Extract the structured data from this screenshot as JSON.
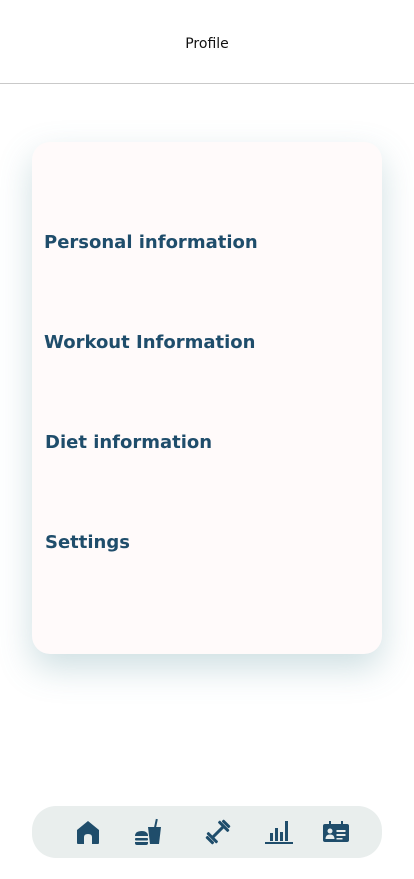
{
  "header": {
    "title": "Profile"
  },
  "menu": {
    "items": [
      {
        "label": "Personal information"
      },
      {
        "label": "Workout Information"
      },
      {
        "label": "Diet information"
      },
      {
        "label": "Settings"
      }
    ]
  },
  "bottom_nav": {
    "items": [
      {
        "icon": "home-icon"
      },
      {
        "icon": "food-drink-icon"
      },
      {
        "icon": "dumbbell-icon"
      },
      {
        "icon": "bar-chart-icon"
      },
      {
        "icon": "profile-card-icon"
      }
    ]
  },
  "colors": {
    "accent": "#1f4d6b",
    "card_background": "#fffafa",
    "nav_background": "#e9eeed"
  }
}
